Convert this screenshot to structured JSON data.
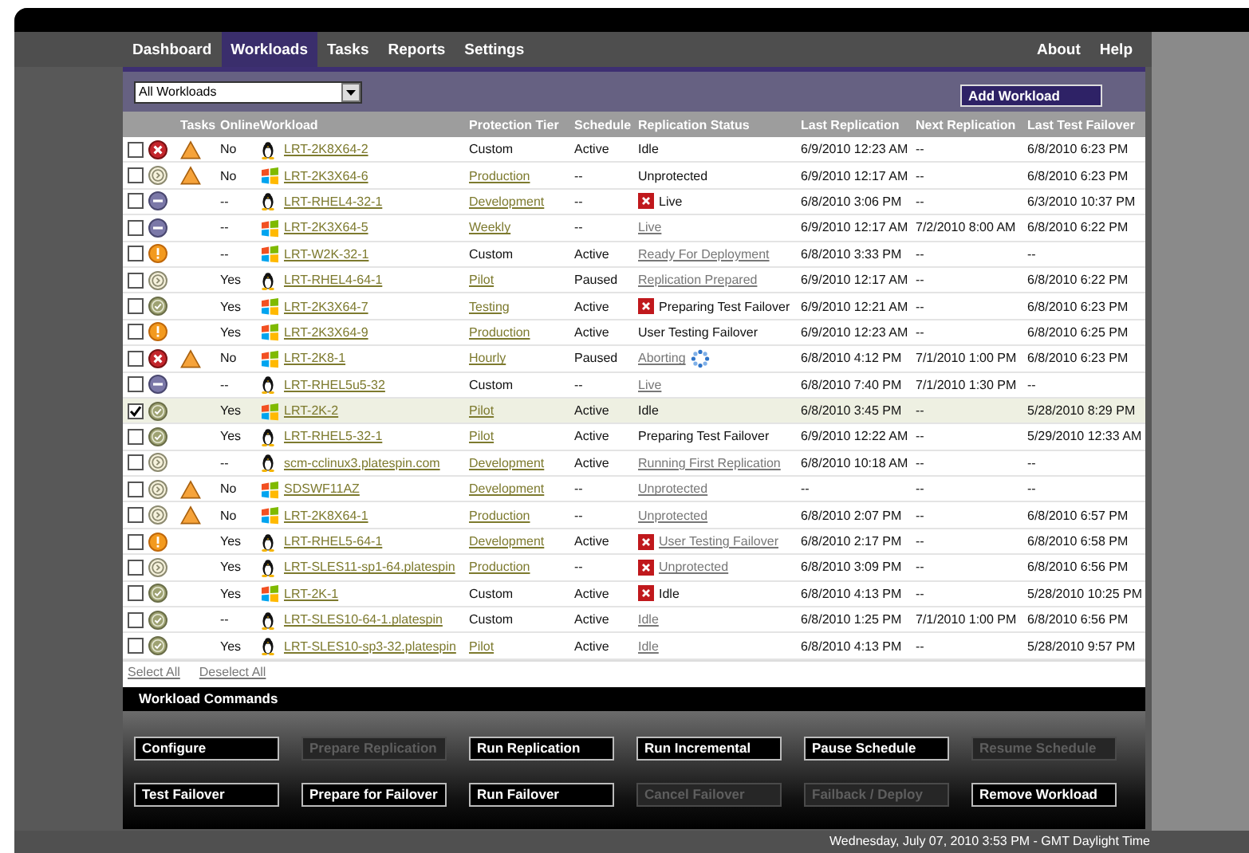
{
  "nav": {
    "tabs": [
      {
        "label": "Dashboard",
        "selected": false
      },
      {
        "label": "Workloads",
        "selected": true
      },
      {
        "label": "Tasks",
        "selected": false
      },
      {
        "label": "Reports",
        "selected": false
      },
      {
        "label": "Settings",
        "selected": false
      }
    ],
    "links": [
      "About",
      "Help"
    ]
  },
  "toolbar": {
    "filter": "All Workloads",
    "add_button": "Add Workload"
  },
  "table": {
    "columns": [
      "Tasks",
      "Online",
      "Workload",
      "Protection Tier",
      "Schedule",
      "Replication Status",
      "Last Replication",
      "Next Replication",
      "Last Test Failover"
    ],
    "rows": [
      {
        "selected": false,
        "checked": false,
        "status_icon": {
          "kind": "error"
        },
        "task_warning": true,
        "online": "No",
        "os_icon": {
          "kind": "linux"
        },
        "workload": "LRT-2K8X64-2",
        "tier": {
          "text": "Custom",
          "link": false
        },
        "schedule": "Active",
        "status": {
          "text": "Idle",
          "link": false,
          "error": false,
          "busy": false
        },
        "last": "6/9/2010 12:23 AM",
        "next": "--",
        "test": "6/8/2010 6:23 PM"
      },
      {
        "selected": false,
        "checked": false,
        "status_icon": {
          "kind": "pending"
        },
        "task_warning": true,
        "online": "No",
        "os_icon": {
          "kind": "windows"
        },
        "workload": "LRT-2K3X64-6",
        "tier": {
          "text": "Production",
          "link": true
        },
        "schedule": "--",
        "status": {
          "text": "Unprotected",
          "link": false,
          "error": false,
          "busy": false
        },
        "last": "6/9/2010 12:17 AM",
        "next": "--",
        "test": "6/8/2010 6:23 PM"
      },
      {
        "selected": false,
        "checked": false,
        "status_icon": {
          "kind": "disabled"
        },
        "task_warning": false,
        "online": "--",
        "os_icon": {
          "kind": "linux"
        },
        "workload": "LRT-RHEL4-32-1",
        "tier": {
          "text": "Development",
          "link": true
        },
        "schedule": "--",
        "status": {
          "text": "Live",
          "link": false,
          "error": true,
          "busy": false
        },
        "last": "6/8/2010 3:06 PM",
        "next": "--",
        "test": "6/3/2010 10:37 PM"
      },
      {
        "selected": false,
        "checked": false,
        "status_icon": {
          "kind": "disabled"
        },
        "task_warning": false,
        "online": "--",
        "os_icon": {
          "kind": "windows"
        },
        "workload": "LRT-2K3X64-5",
        "tier": {
          "text": "Weekly",
          "link": true
        },
        "schedule": "--",
        "status": {
          "text": "Live",
          "link": true,
          "error": false,
          "busy": false
        },
        "last": "6/9/2010 12:17 AM",
        "next": "7/2/2010 8:00 AM",
        "test": "6/8/2010 6:22 PM"
      },
      {
        "selected": false,
        "checked": false,
        "status_icon": {
          "kind": "warning"
        },
        "task_warning": false,
        "online": "--",
        "os_icon": {
          "kind": "windows"
        },
        "workload": "LRT-W2K-32-1",
        "tier": {
          "text": "Custom",
          "link": false
        },
        "schedule": "Active",
        "status": {
          "text": "Ready For Deployment",
          "link": true,
          "error": false,
          "busy": false
        },
        "last": "6/8/2010 3:33 PM",
        "next": "--",
        "test": "--"
      },
      {
        "selected": false,
        "checked": false,
        "status_icon": {
          "kind": "pending"
        },
        "task_warning": false,
        "online": "Yes",
        "os_icon": {
          "kind": "linux"
        },
        "workload": "LRT-RHEL4-64-1",
        "tier": {
          "text": "Pilot",
          "link": true
        },
        "schedule": "Paused",
        "status": {
          "text": "Replication Prepared",
          "link": true,
          "error": false,
          "busy": false
        },
        "last": "6/9/2010 12:17 AM",
        "next": "--",
        "test": "6/8/2010 6:22 PM"
      },
      {
        "selected": false,
        "checked": false,
        "status_icon": {
          "kind": "ok"
        },
        "task_warning": false,
        "online": "Yes",
        "os_icon": {
          "kind": "windows"
        },
        "workload": "LRT-2K3X64-7",
        "tier": {
          "text": "Testing",
          "link": true
        },
        "schedule": "Active",
        "status": {
          "text": "Preparing Test Failover",
          "link": false,
          "error": true,
          "busy": false
        },
        "last": "6/9/2010 12:21 AM",
        "next": "--",
        "test": "6/8/2010 6:23 PM"
      },
      {
        "selected": false,
        "checked": false,
        "status_icon": {
          "kind": "warning"
        },
        "task_warning": false,
        "online": "Yes",
        "os_icon": {
          "kind": "windows"
        },
        "workload": "LRT-2K3X64-9",
        "tier": {
          "text": "Production",
          "link": true
        },
        "schedule": "Active",
        "status": {
          "text": "User Testing Failover",
          "link": false,
          "error": false,
          "busy": false
        },
        "last": "6/9/2010 12:23 AM",
        "next": "--",
        "test": "6/8/2010 6:25 PM"
      },
      {
        "selected": false,
        "checked": false,
        "status_icon": {
          "kind": "error"
        },
        "task_warning": true,
        "online": "No",
        "os_icon": {
          "kind": "windows"
        },
        "workload": "LRT-2K8-1",
        "tier": {
          "text": "Hourly",
          "link": true
        },
        "schedule": "Paused",
        "status": {
          "text": "Aborting",
          "link": true,
          "error": false,
          "busy": true
        },
        "last": "6/8/2010 4:12 PM",
        "next": "7/1/2010 1:00 PM",
        "test": "6/8/2010 6:23 PM"
      },
      {
        "selected": false,
        "checked": false,
        "status_icon": {
          "kind": "disabled"
        },
        "task_warning": false,
        "online": "--",
        "os_icon": {
          "kind": "linux"
        },
        "workload": "LRT-RHEL5u5-32",
        "tier": {
          "text": "Custom",
          "link": false
        },
        "schedule": "--",
        "status": {
          "text": "Live",
          "link": true,
          "error": false,
          "busy": false
        },
        "last": "6/8/2010 7:40 PM",
        "next": "7/1/2010 1:30 PM",
        "test": "--"
      },
      {
        "selected": true,
        "checked": true,
        "status_icon": {
          "kind": "ok"
        },
        "task_warning": false,
        "online": "Yes",
        "os_icon": {
          "kind": "windows"
        },
        "workload": "LRT-2K-2",
        "tier": {
          "text": "Pilot",
          "link": true
        },
        "schedule": "Active",
        "status": {
          "text": "Idle",
          "link": false,
          "error": false,
          "busy": false
        },
        "last": "6/8/2010 3:45 PM",
        "next": "--",
        "test": "5/28/2010 8:29 PM"
      },
      {
        "selected": false,
        "checked": false,
        "status_icon": {
          "kind": "ok"
        },
        "task_warning": false,
        "online": "Yes",
        "os_icon": {
          "kind": "linux"
        },
        "workload": "LRT-RHEL5-32-1",
        "tier": {
          "text": "Pilot",
          "link": true
        },
        "schedule": "Active",
        "status": {
          "text": "Preparing Test Failover",
          "link": false,
          "error": false,
          "busy": false
        },
        "last": "6/9/2010 12:22 AM",
        "next": "--",
        "test": "5/29/2010 12:33 AM"
      },
      {
        "selected": false,
        "checked": false,
        "status_icon": {
          "kind": "pending"
        },
        "task_warning": false,
        "online": "--",
        "os_icon": {
          "kind": "linux"
        },
        "workload": "scm-cclinux3.platespin.com",
        "tier": {
          "text": "Development",
          "link": true
        },
        "schedule": "Active",
        "status": {
          "text": "Running First Replication",
          "link": true,
          "error": false,
          "busy": false
        },
        "last": "6/8/2010 10:18 AM",
        "next": "--",
        "test": "--"
      },
      {
        "selected": false,
        "checked": false,
        "status_icon": {
          "kind": "pending"
        },
        "task_warning": true,
        "online": "No",
        "os_icon": {
          "kind": "windows"
        },
        "workload": "SDSWF11AZ",
        "tier": {
          "text": "Development",
          "link": true
        },
        "schedule": "--",
        "status": {
          "text": "Unprotected",
          "link": true,
          "error": false,
          "busy": false
        },
        "last": "--",
        "next": "--",
        "test": "--"
      },
      {
        "selected": false,
        "checked": false,
        "status_icon": {
          "kind": "pending"
        },
        "task_warning": true,
        "online": "No",
        "os_icon": {
          "kind": "windows"
        },
        "workload": "LRT-2K8X64-1",
        "tier": {
          "text": "Production",
          "link": true
        },
        "schedule": "--",
        "status": {
          "text": "Unprotected",
          "link": true,
          "error": false,
          "busy": false
        },
        "last": "6/8/2010 2:07 PM",
        "next": "--",
        "test": "6/8/2010 6:57 PM"
      },
      {
        "selected": false,
        "checked": false,
        "status_icon": {
          "kind": "warning"
        },
        "task_warning": false,
        "online": "Yes",
        "os_icon": {
          "kind": "linux"
        },
        "workload": "LRT-RHEL5-64-1",
        "tier": {
          "text": "Development",
          "link": true
        },
        "schedule": "Active",
        "status": {
          "text": "User Testing Failover",
          "link": true,
          "error": true,
          "busy": false
        },
        "last": "6/8/2010 2:17 PM",
        "next": "--",
        "test": "6/8/2010 6:58 PM"
      },
      {
        "selected": false,
        "checked": false,
        "status_icon": {
          "kind": "pending"
        },
        "task_warning": false,
        "online": "Yes",
        "os_icon": {
          "kind": "linux"
        },
        "workload": "LRT-SLES11-sp1-64.platespin",
        "tier": {
          "text": "Production",
          "link": true
        },
        "schedule": "--",
        "status": {
          "text": "Unprotected",
          "link": true,
          "error": true,
          "busy": false
        },
        "last": "6/8/2010 3:09 PM",
        "next": "--",
        "test": "6/8/2010 6:56 PM"
      },
      {
        "selected": false,
        "checked": false,
        "status_icon": {
          "kind": "ok"
        },
        "task_warning": false,
        "online": "Yes",
        "os_icon": {
          "kind": "windows"
        },
        "workload": "LRT-2K-1",
        "tier": {
          "text": "Custom",
          "link": false
        },
        "schedule": "Active",
        "status": {
          "text": "Idle",
          "link": false,
          "error": true,
          "busy": false
        },
        "last": "6/8/2010 4:13 PM",
        "next": "--",
        "test": "5/28/2010 10:25 PM"
      },
      {
        "selected": false,
        "checked": false,
        "status_icon": {
          "kind": "ok"
        },
        "task_warning": false,
        "online": "--",
        "os_icon": {
          "kind": "linux"
        },
        "workload": "LRT-SLES10-64-1.platespin",
        "tier": {
          "text": "Custom",
          "link": false
        },
        "schedule": "Active",
        "status": {
          "text": "Idle",
          "link": true,
          "error": false,
          "busy": false
        },
        "last": "6/8/2010 1:25 PM",
        "next": "7/1/2010 1:00 PM",
        "test": "6/8/2010 6:56 PM"
      },
      {
        "selected": false,
        "checked": false,
        "status_icon": {
          "kind": "ok"
        },
        "task_warning": false,
        "online": "Yes",
        "os_icon": {
          "kind": "linux"
        },
        "workload": "LRT-SLES10-sp3-32.platespin",
        "tier": {
          "text": "Pilot",
          "link": true
        },
        "schedule": "Active",
        "status": {
          "text": "Idle",
          "link": true,
          "error": false,
          "busy": false
        },
        "last": "6/8/2010 4:13 PM",
        "next": "--",
        "test": "5/28/2010 9:57 PM"
      }
    ],
    "footer_links": [
      "Select All",
      "Deselect All"
    ]
  },
  "commands": {
    "title": "Workload Commands",
    "rows": [
      [
        {
          "label": "Configure",
          "disabled": false
        },
        {
          "label": "Prepare Replication",
          "disabled": true
        },
        {
          "label": "Run Replication",
          "disabled": false
        },
        {
          "label": "Run Incremental",
          "disabled": false
        },
        {
          "label": "Pause Schedule",
          "disabled": false
        },
        {
          "label": "Resume Schedule",
          "disabled": true
        }
      ],
      [
        {
          "label": "Test Failover",
          "disabled": false
        },
        {
          "label": "Prepare for Failover",
          "disabled": false
        },
        {
          "label": "Run Failover",
          "disabled": false
        },
        {
          "label": "Cancel Failover",
          "disabled": true
        },
        {
          "label": "Failback / Deploy",
          "disabled": true
        },
        {
          "label": "Remove Workload",
          "disabled": false
        }
      ]
    ]
  },
  "status_bar": "Wednesday, July 07, 2010 3:53 PM - GMT Daylight Time"
}
